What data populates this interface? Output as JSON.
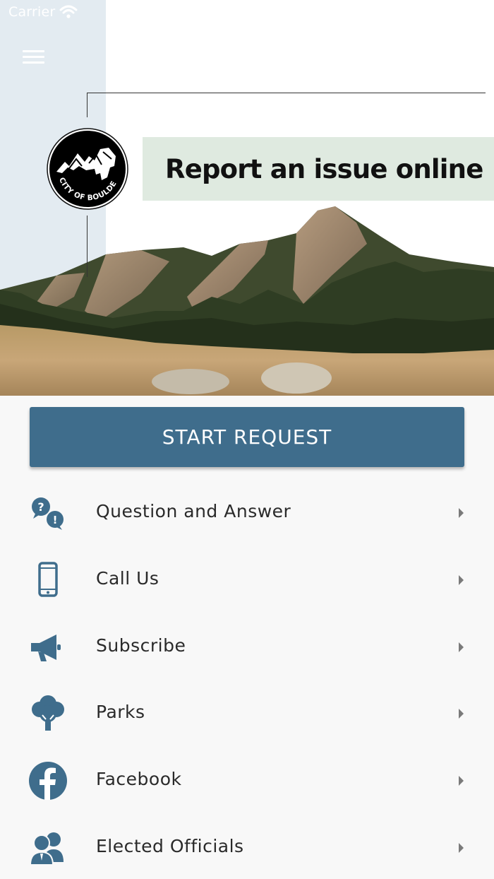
{
  "status_bar": {
    "carrier": "Carrier",
    "wifi_icon": "wifi-icon"
  },
  "header": {
    "menu_icon": "hamburger-menu-icon",
    "logo_text": "CITY OF BOULDER",
    "banner_title": "Report an issue online",
    "side_panel_color": "#e3ebf1",
    "banner_color": "#dfeae0"
  },
  "start_request": {
    "label": "START REQUEST",
    "color": "#3f6d8c"
  },
  "menu": {
    "icon_color": "#3f6d8c",
    "items": [
      {
        "label": "Question and Answer",
        "icon": "question-answer-icon"
      },
      {
        "label": "Call Us",
        "icon": "phone-icon"
      },
      {
        "label": "Subscribe",
        "icon": "megaphone-icon"
      },
      {
        "label": "Parks",
        "icon": "tree-icon"
      },
      {
        "label": "Facebook",
        "icon": "facebook-icon"
      },
      {
        "label": "Elected Officials",
        "icon": "officials-icon"
      }
    ]
  }
}
